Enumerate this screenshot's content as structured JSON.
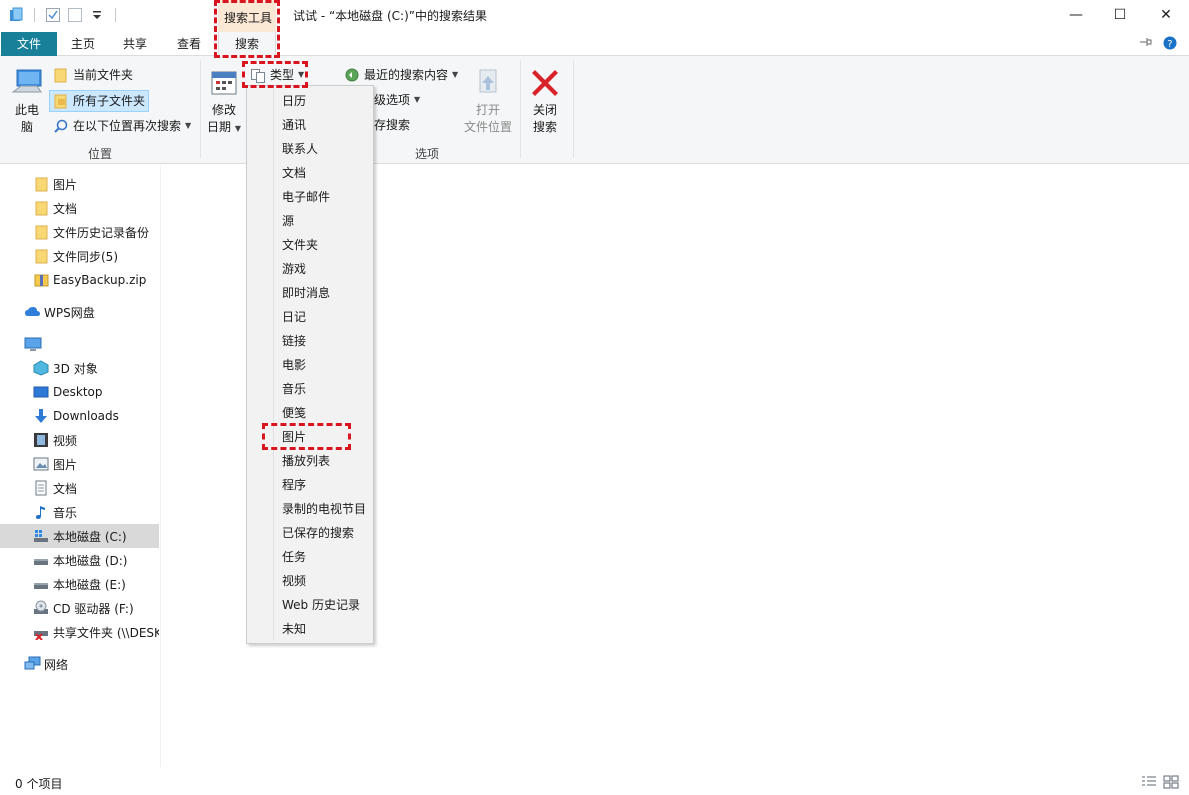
{
  "window": {
    "title": "试试 - “本地磁盘 (C:)”中的搜索结果",
    "context_group": "搜索工具",
    "minimize": "—",
    "maximize": "☐",
    "close": "✕"
  },
  "tabs": {
    "file": "文件",
    "home": "主页",
    "share": "共享",
    "view": "查看",
    "search": "搜索"
  },
  "ribbon": {
    "location": {
      "this_pc_line1": "此电",
      "this_pc_line2": "脑",
      "current_folder": "当前文件夹",
      "all_subfolders": "所有子文件夹",
      "search_again_in": "在以下位置再次搜索",
      "label": "位置"
    },
    "refine": {
      "date_modified_line1": "修改",
      "date_modified_line2": "日期",
      "kind": "类型"
    },
    "options": {
      "recent_searches": "最近的搜索内容",
      "advanced_options": "级选项",
      "save_search": "存搜索",
      "open_file_location_line1": "打开",
      "open_file_location_line2": "文件位置",
      "label": "选项"
    },
    "close_search_line1": "关闭",
    "close_search_line2": "搜索"
  },
  "nav": {
    "items": [
      {
        "label": "图片",
        "icon": "folder-icon"
      },
      {
        "label": "文档",
        "icon": "folder-icon"
      },
      {
        "label": "文件历史记录备份",
        "icon": "folder-icon"
      },
      {
        "label": "文件同步(5)",
        "icon": "folder-icon"
      },
      {
        "label": "EasyBackup.zip",
        "icon": "zip-folder-icon"
      },
      {
        "label": "WPS网盘",
        "icon": "cloud-icon"
      },
      {
        "label": "",
        "icon": "this-pc-icon"
      },
      {
        "label": "3D 对象",
        "icon": "3d-objects-icon"
      },
      {
        "label": "Desktop",
        "icon": "desktop-icon"
      },
      {
        "label": "Downloads",
        "icon": "download-icon"
      },
      {
        "label": "视频",
        "icon": "video-icon"
      },
      {
        "label": "图片",
        "icon": "pictures-icon"
      },
      {
        "label": "文档",
        "icon": "documents-icon"
      },
      {
        "label": "音乐",
        "icon": "music-icon"
      },
      {
        "label": "本地磁盘 (C:)",
        "icon": "windows-drive-icon"
      },
      {
        "label": "本地磁盘 (D:)",
        "icon": "drive-icon"
      },
      {
        "label": "本地磁盘 (E:)",
        "icon": "drive-icon"
      },
      {
        "label": "CD 驱动器 (F:)",
        "icon": "cd-drive-icon"
      },
      {
        "label": "共享文件夹 (\\\\DESK",
        "icon": "network-drive-disconnected-icon"
      },
      {
        "label": "网络",
        "icon": "network-icon"
      }
    ]
  },
  "kind_menu": {
    "items": [
      "日历",
      "通讯",
      "联系人",
      "文档",
      "电子邮件",
      "源",
      "文件夹",
      "游戏",
      "即时消息",
      "日记",
      "链接",
      "电影",
      "音乐",
      "便笺",
      "图片",
      "播放列表",
      "程序",
      "录制的电视节目",
      "已保存的搜索",
      "任务",
      "视频",
      "Web 历史记录",
      "未知"
    ]
  },
  "status": {
    "item_count": "0 个项目"
  },
  "colors": {
    "file_tab": "#19809a",
    "context_tab": "#fbe9d6",
    "selection": "#cce8ff",
    "annotation": "#d9141e"
  }
}
